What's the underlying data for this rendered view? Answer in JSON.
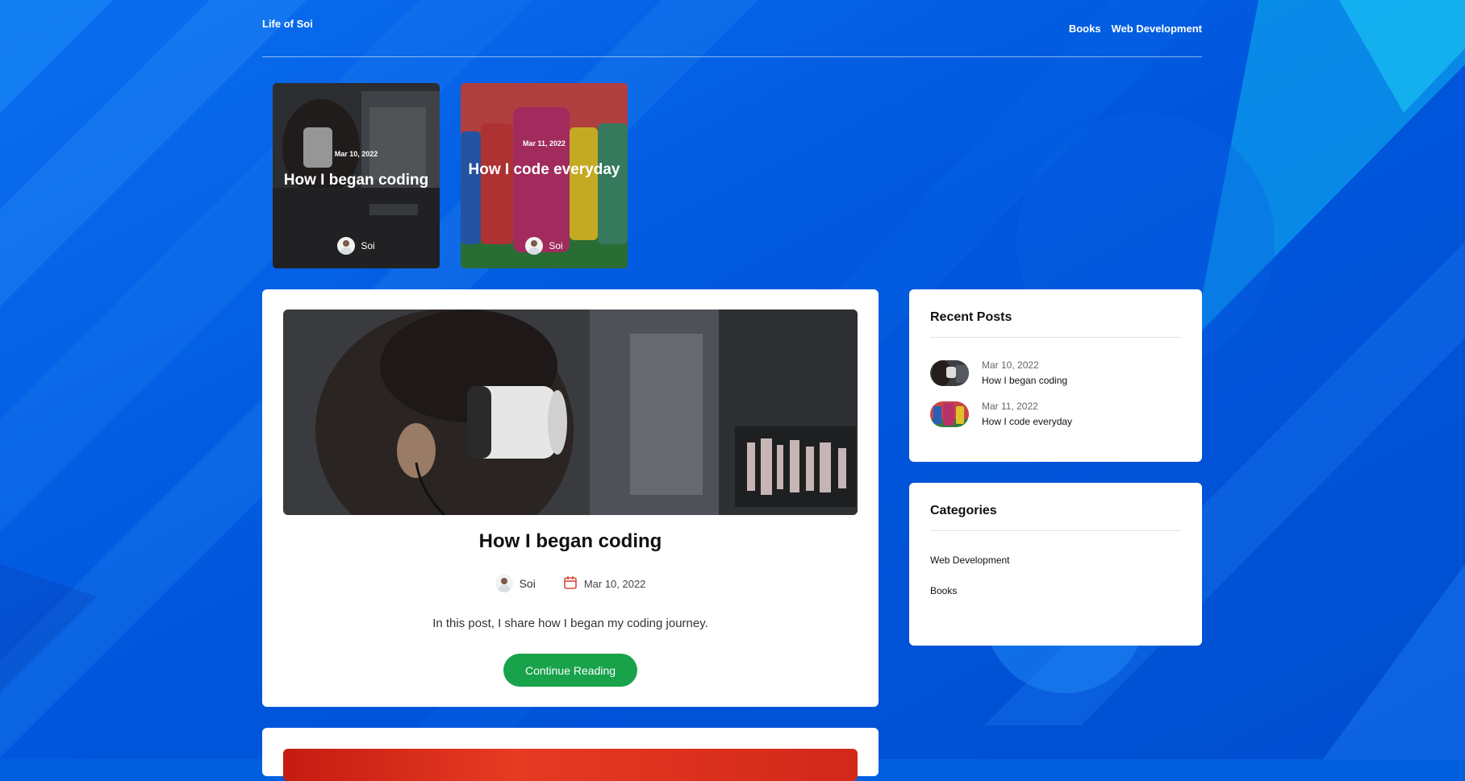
{
  "site": {
    "title": "Life of Soi"
  },
  "nav": {
    "items": [
      "Books",
      "Web Development"
    ]
  },
  "featured": [
    {
      "date": "Mar 10, 2022",
      "title": "How I began coding",
      "author": "Soi"
    },
    {
      "date": "Mar 11, 2022",
      "title": "How I code everyday",
      "author": "Soi"
    }
  ],
  "post": {
    "title": "How I began coding",
    "author": "Soi",
    "date": "Mar 10, 2022",
    "excerpt": "In this post, I share how I began my coding journey.",
    "button": "Continue Reading"
  },
  "sidebar": {
    "recent_title": "Recent Posts",
    "recent": [
      {
        "date": "Mar 10, 2022",
        "title": "How I began coding"
      },
      {
        "date": "Mar 11, 2022",
        "title": "How I code everyday"
      }
    ],
    "categories_title": "Categories",
    "categories": [
      "Web Development",
      "Books"
    ]
  },
  "colors": {
    "accent_button": "#18a24a",
    "background": "#0060e0",
    "calendar_icon": "#d94a3a"
  }
}
